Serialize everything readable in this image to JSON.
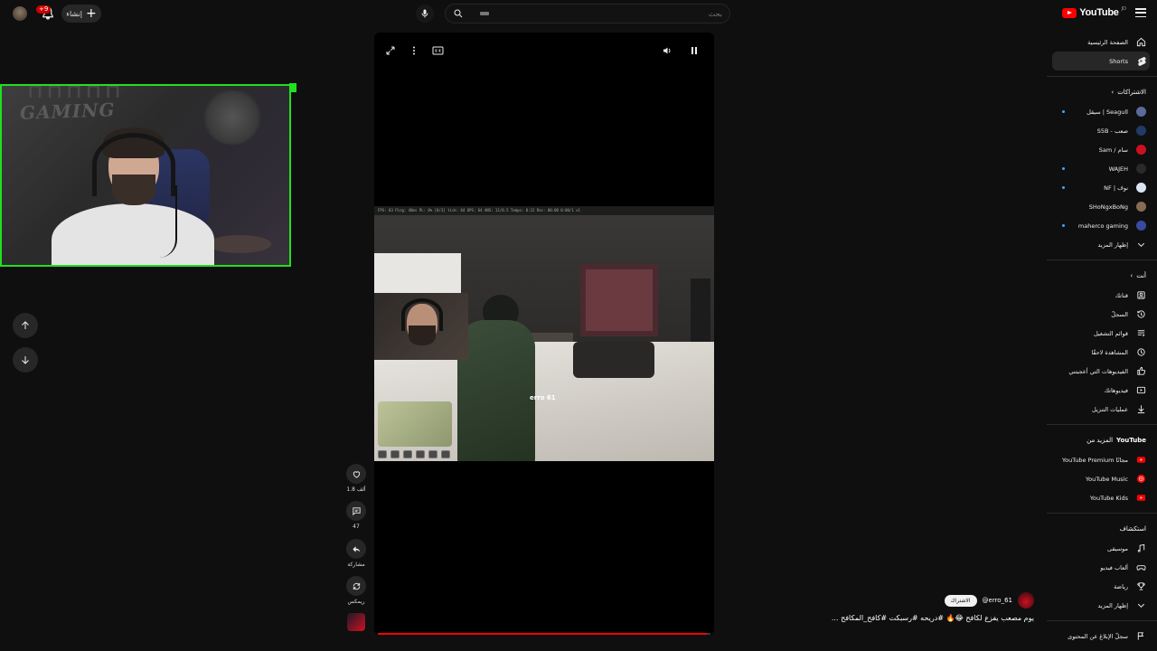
{
  "topbar": {
    "notification_count": "+9",
    "create_label": "إنشاء",
    "search_placeholder": "بحث"
  },
  "brand": {
    "name": "YouTube",
    "country": "JO"
  },
  "player": {
    "progress": 0.99,
    "in_game_tag": "erro 61",
    "hud_text": "FPS: 83   Ping: 48ms   PL: 0%   [0/3] tick: 64   UPS: 64   ANS: 11/0.5  Tempo: 0:12 Rec:  00:00  0:00/1 x1"
  },
  "actions": {
    "like_count": "1.8 ألف",
    "comment_count": "47",
    "share_label": "مشاركة",
    "remix_label": "ريمكس"
  },
  "caption": {
    "handle": "@erro_61",
    "subscribe_label": "الاشتراك",
    "title": "يوم مصعب يفزع لكافح 😂🔥 #دريحه #رسبكت #كافح_المكافح ..."
  },
  "sidebar": {
    "main": [
      {
        "label": "الصفحة الرئيسية",
        "icon": "home-icon"
      },
      {
        "label": "Shorts",
        "icon": "shorts-icon"
      }
    ],
    "subscriptions_title": "الاشتراكات",
    "subscriptions": [
      {
        "label": "سيقل | Seagull",
        "color": "#5a6a9a",
        "dot": true
      },
      {
        "label": "S5B - صعب",
        "color": "#223a66",
        "dot": false
      },
      {
        "label": "Sam / سام",
        "color": "#cc1020",
        "dot": false
      },
      {
        "label": "WAJEH",
        "color": "#2a2a2a",
        "dot": true
      },
      {
        "label": "NF | نوف",
        "color": "#d9e6f2",
        "dot": true
      },
      {
        "label": "SHoNgxBoNg",
        "color": "#8a6a55",
        "dot": false
      },
      {
        "label": "maherco gaming",
        "color": "#3a4aa0",
        "dot": true
      }
    ],
    "show_more_1": "إظهار المزيد",
    "you_title": "أنت",
    "you": [
      {
        "label": "قناتك",
        "icon": "user-icon"
      },
      {
        "label": "السجلّ",
        "icon": "history-icon"
      },
      {
        "label": "قوائم التشغيل",
        "icon": "playlist-icon"
      },
      {
        "label": "المشاهدة لاحقًا",
        "icon": "clock-icon"
      },
      {
        "label": "الفيديوهات التي أعجبتني",
        "icon": "thumb-up-icon"
      },
      {
        "label": "فيديوهاتك",
        "icon": "video-icon"
      },
      {
        "label": "عمليات التنزيل",
        "icon": "download-icon"
      }
    ],
    "more_from_prefix": "المزيد من",
    "more_from_brand": "YouTube",
    "more_from": [
      {
        "label": "YouTube Premium مجانًا",
        "icon": "yt-premium-icon"
      },
      {
        "label": "YouTube Music",
        "icon": "yt-music-icon"
      },
      {
        "label": "YouTube Kids",
        "icon": "yt-kids-icon"
      }
    ],
    "explore_title": "استكشاف",
    "explore": [
      {
        "label": "موسيقى",
        "icon": "music-icon"
      },
      {
        "label": "ألعاب فيديو",
        "icon": "gamepad-icon"
      },
      {
        "label": "رياضة",
        "icon": "trophy-icon"
      }
    ],
    "show_more_2": "إظهار المزيد",
    "report_label": "سجلّ الإبلاغ عن المحتوى"
  },
  "colors": {
    "accent": "#ff0000",
    "webcam_border": "#20e020",
    "subscribed_dot": "#3ea6ff"
  }
}
